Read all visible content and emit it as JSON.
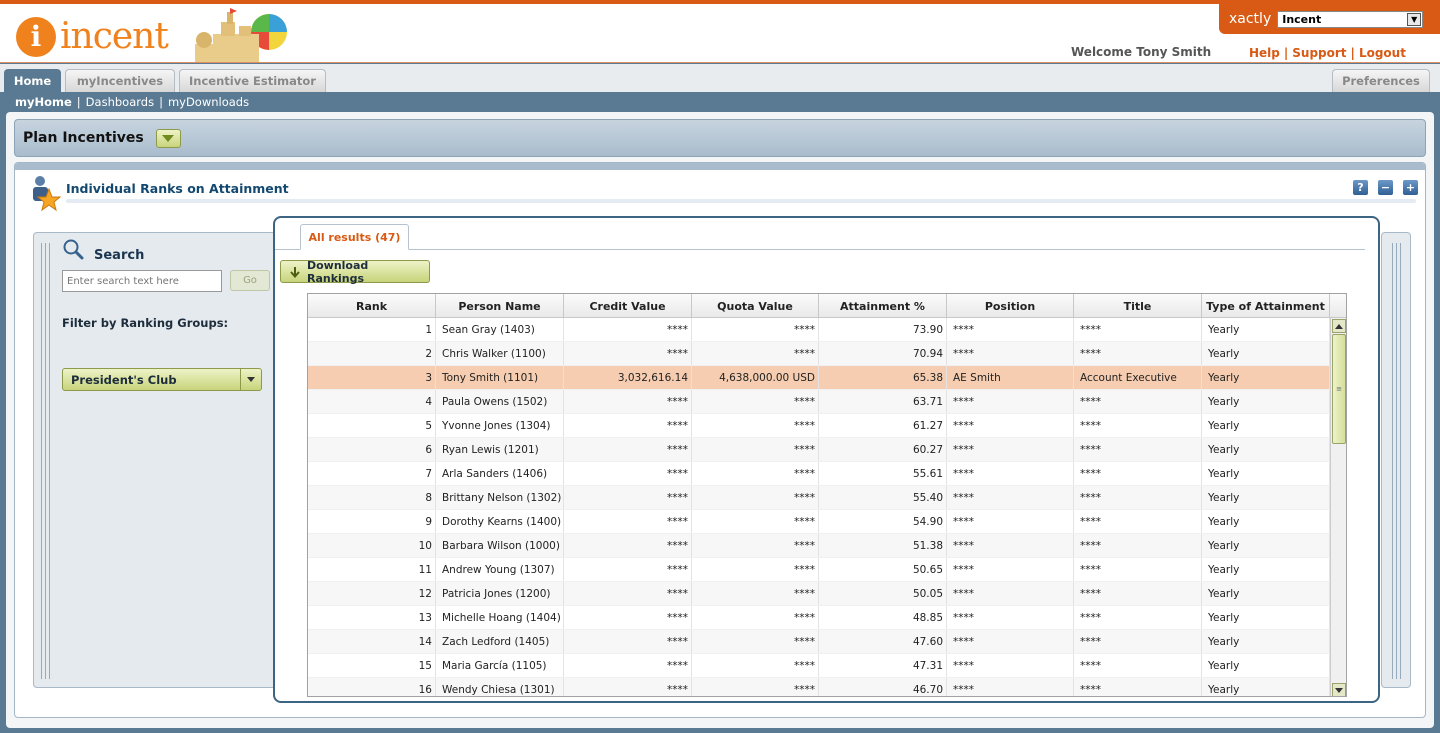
{
  "app": {
    "logo_word": "incent",
    "brand": "xactly",
    "app_selector_value": "Incent",
    "welcome": "Welcome Tony Smith",
    "links": {
      "help": "Help",
      "support": "Support",
      "logout": "Logout",
      "sep": "|"
    }
  },
  "nav": {
    "tabs": [
      {
        "label": "Home"
      },
      {
        "label": "myIncentives"
      },
      {
        "label": "Incentive Estimator"
      }
    ],
    "preferences": "Preferences",
    "sub": {
      "current": "myHome",
      "sep": "|",
      "dashboards": "Dashboards",
      "downloads": "myDownloads"
    }
  },
  "plan": {
    "title": "Plan Incentives"
  },
  "portlet": {
    "title": "Individual Ranks on Attainment",
    "controls": {
      "help": "?",
      "minimize": "−",
      "maximize": "+"
    }
  },
  "search": {
    "title": "Search",
    "placeholder": "Enter search text here",
    "go": "Go",
    "filter_label": "Filter by Ranking Groups:",
    "group_value": "President's Club"
  },
  "results": {
    "tab_label": "All results (47)",
    "download_label": "Download Rankings",
    "columns": [
      "Rank",
      "Person Name",
      "Credit Value",
      "Quota Value",
      "Attainment %",
      "Position",
      "Title",
      "Type of Attainment"
    ],
    "rows": [
      [
        "1",
        "Sean Gray (1403)",
        "****",
        "****",
        "73.90",
        "****",
        "****",
        "Yearly"
      ],
      [
        "2",
        "Chris Walker (1100)",
        "****",
        "****",
        "70.94",
        "****",
        "****",
        "Yearly"
      ],
      [
        "3",
        "Tony Smith (1101)",
        "3,032,616.14",
        "4,638,000.00 USD",
        "65.38",
        "AE Smith",
        "Account Executive",
        "Yearly"
      ],
      [
        "4",
        "Paula Owens (1502)",
        "****",
        "****",
        "63.71",
        "****",
        "****",
        "Yearly"
      ],
      [
        "5",
        "Yvonne Jones (1304)",
        "****",
        "****",
        "61.27",
        "****",
        "****",
        "Yearly"
      ],
      [
        "6",
        "Ryan Lewis (1201)",
        "****",
        "****",
        "60.27",
        "****",
        "****",
        "Yearly"
      ],
      [
        "7",
        "Arla Sanders (1406)",
        "****",
        "****",
        "55.61",
        "****",
        "****",
        "Yearly"
      ],
      [
        "8",
        "Brittany Nelson (1302)",
        "****",
        "****",
        "55.40",
        "****",
        "****",
        "Yearly"
      ],
      [
        "9",
        "Dorothy Kearns (1400)",
        "****",
        "****",
        "54.90",
        "****",
        "****",
        "Yearly"
      ],
      [
        "10",
        "Barbara Wilson (1000)",
        "****",
        "****",
        "51.38",
        "****",
        "****",
        "Yearly"
      ],
      [
        "11",
        "Andrew Young (1307)",
        "****",
        "****",
        "50.65",
        "****",
        "****",
        "Yearly"
      ],
      [
        "12",
        "Patricia Jones (1200)",
        "****",
        "****",
        "50.05",
        "****",
        "****",
        "Yearly"
      ],
      [
        "13",
        "Michelle Hoang (1404)",
        "****",
        "****",
        "48.85",
        "****",
        "****",
        "Yearly"
      ],
      [
        "14",
        "Zach Ledford (1405)",
        "****",
        "****",
        "47.60",
        "****",
        "****",
        "Yearly"
      ],
      [
        "15",
        "Maria García (1105)",
        "****",
        "****",
        "47.31",
        "****",
        "****",
        "Yearly"
      ],
      [
        "16",
        "Wendy Chiesa (1301)",
        "****",
        "****",
        "46.70",
        "****",
        "****",
        "Yearly"
      ]
    ],
    "highlight_row_index": 2,
    "highlight_color": "#f6cdb0"
  },
  "colors": {
    "accent": "#d85a14",
    "nav_blue": "#5a7a93",
    "title_blue": "#134970",
    "button_green": "#c8d47a"
  }
}
